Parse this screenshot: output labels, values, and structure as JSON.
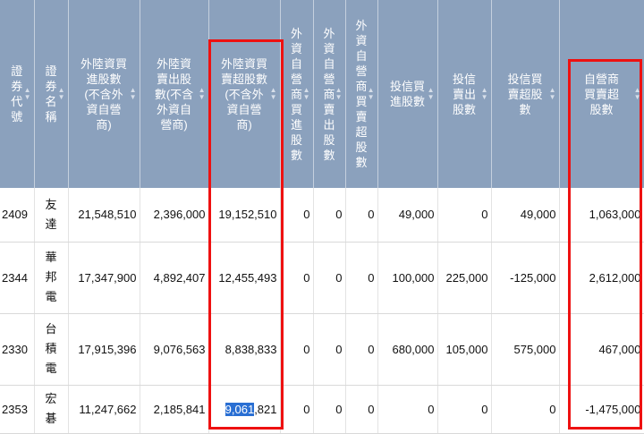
{
  "columns": [
    {
      "key": "code",
      "label": "證\n券\n代\n號"
    },
    {
      "key": "name",
      "label": "證\n券\n名\n稱"
    },
    {
      "key": "f_buy",
      "label": "外陸資買\n進股數\n(不含外\n資自營\n商)"
    },
    {
      "key": "f_sell",
      "label": "外陸資\n賣出股\n數(不含\n外資自\n營商)"
    },
    {
      "key": "f_net",
      "label": "外陸資買\n賣超股數\n(不含外\n資自營\n商)"
    },
    {
      "key": "fd_buy",
      "label": "外\n資\n自\n營\n商\n買\n進\n股\n數"
    },
    {
      "key": "fd_sell",
      "label": "外\n資\n自\n營\n商\n賣\n出\n股\n數"
    },
    {
      "key": "fd_net",
      "label": "外\n資\n自\n營\n商\n買\n賣\n超\n股\n數"
    },
    {
      "key": "it_buy",
      "label": "投信買\n進股數"
    },
    {
      "key": "it_sell",
      "label": "投信\n賣出\n股數"
    },
    {
      "key": "it_net",
      "label": "投信買\n賣超股\n數"
    },
    {
      "key": "d_net",
      "label": "自營商\n買賣超\n股數"
    }
  ],
  "rows": [
    {
      "code": "2409",
      "name": "友\n達",
      "f_buy": "21,548,510",
      "f_sell": "2,396,000",
      "f_net": "19,152,510",
      "fd_buy": "0",
      "fd_sell": "0",
      "fd_net": "0",
      "it_buy": "49,000",
      "it_sell": "0",
      "it_net": "49,000",
      "d_net": "1,063,000"
    },
    {
      "code": "2344",
      "name": "華\n邦\n電",
      "f_buy": "17,347,900",
      "f_sell": "4,892,407",
      "f_net": "12,455,493",
      "fd_buy": "0",
      "fd_sell": "0",
      "fd_net": "0",
      "it_buy": "100,000",
      "it_sell": "225,000",
      "it_net": "-125,000",
      "d_net": "2,612,000"
    },
    {
      "code": "2330",
      "name": "台\n積\n電",
      "f_buy": "17,915,396",
      "f_sell": "9,076,563",
      "f_net": "8,838,833",
      "fd_buy": "0",
      "fd_sell": "0",
      "fd_net": "0",
      "it_buy": "680,000",
      "it_sell": "105,000",
      "it_net": "575,000",
      "d_net": "467,000"
    },
    {
      "code": "2353",
      "name": "宏\n碁",
      "f_buy": "11,247,662",
      "f_sell": "2,185,841",
      "f_net_selected": "9,061",
      "f_net_rest": ",821",
      "fd_buy": "0",
      "fd_sell": "0",
      "fd_net": "0",
      "it_buy": "0",
      "it_sell": "0",
      "it_net": "0",
      "d_net": "-1,475,000"
    }
  ]
}
